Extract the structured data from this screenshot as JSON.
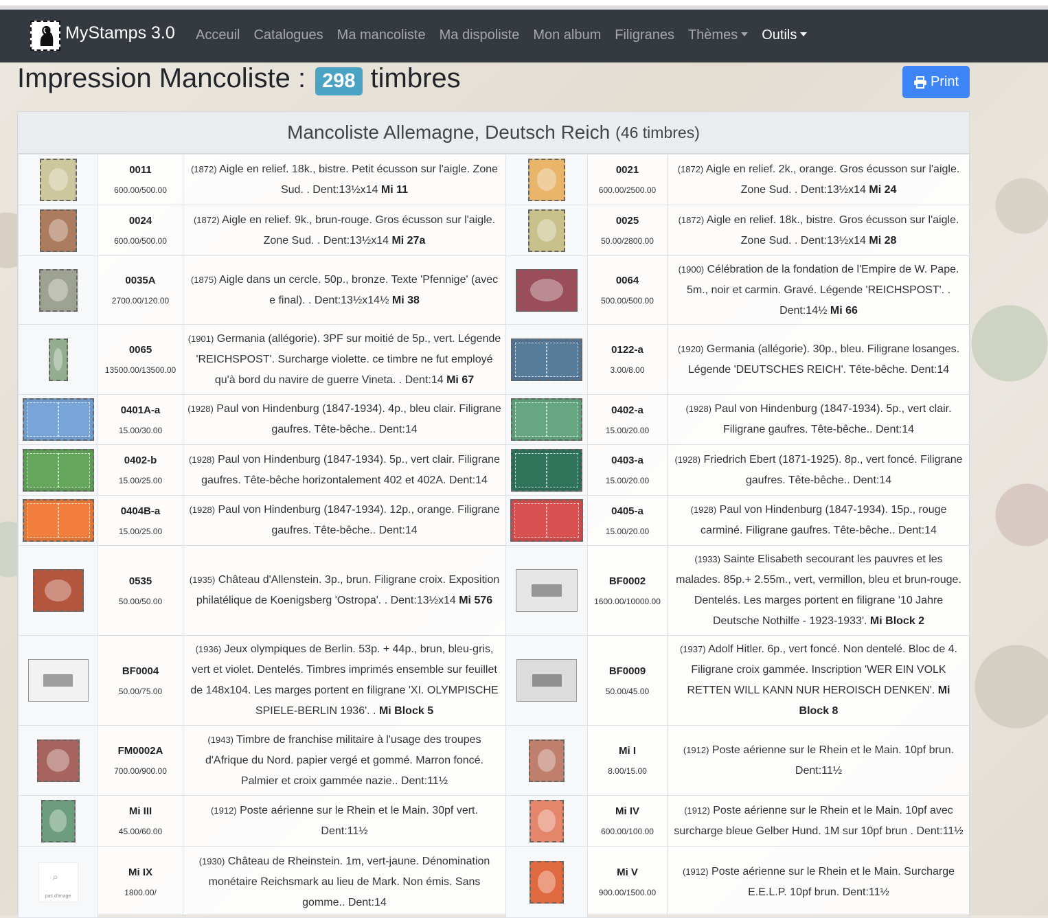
{
  "nav": {
    "brand": "MyStamps 3.0",
    "links": [
      "Acceuil",
      "Catalogues",
      "Ma mancoliste",
      "Ma dispoliste",
      "Mon album",
      "Filigranes",
      "Thèmes",
      "Outils"
    ]
  },
  "page": {
    "title": "Impression Mancoliste :",
    "count": "298",
    "unit": "timbres",
    "print_label": "Print"
  },
  "panel": {
    "title": "Mancoliste Allemagne, Deutsch Reich",
    "count": "(46 timbres)"
  },
  "rows": [
    [
      {
        "code": "0011",
        "price": "600.00/500.00",
        "year": "(1872)",
        "text": "Aigle en relief. 18k., bistre. Petit écusson sur l'aigle. Zone Sud. . Dent:13½x14",
        "mi": "Mi 11",
        "color": "#ccc79c"
      },
      {
        "code": "0021",
        "price": "600.00/2500.00",
        "year": "(1872)",
        "text": "Aigle en relief. 2k., orange. Gros écusson sur l'aigle. Zone Sud. . Dent:13½x14",
        "mi": "Mi 24",
        "color": "#e9b56a"
      }
    ],
    [
      {
        "code": "0024",
        "price": "600.00/500.00",
        "year": "(1872)",
        "text": "Aigle en relief. 9k., brun-rouge. Gros écusson sur l'aigle. Zone Sud. . Dent:13½x14",
        "mi": "Mi 27a",
        "color": "#ad7b5d"
      },
      {
        "code": "0025",
        "price": "50.00/2800.00",
        "year": "(1872)",
        "text": "Aigle en relief. 18k., bistre. Gros écusson sur l'aigle. Zone Sud. . Dent:13½x14",
        "mi": "Mi 28",
        "color": "#c8c18b"
      }
    ],
    [
      {
        "code": "0035A",
        "price": "2700.00/120.00",
        "year": "(1875)",
        "text": "Aigle dans un cercle. 50p., bronze. Texte 'Pfennige' (avec e final). . Dent:13½x14½",
        "mi": "Mi 38",
        "color": "#9ea293"
      },
      {
        "code": "0064",
        "price": "500.00/500.00",
        "year": "(1900)",
        "text": "Célébration de la fondation de l'Empire de W. Pape. 5m., noir et carmin. Gravé. Légende 'REICHSPOST'. . Dent:14½",
        "mi": "Mi 66",
        "color": "#9a4d5b"
      }
    ],
    [
      {
        "code": "0065",
        "price": "13500.00/13500.00",
        "year": "(1901)",
        "text": "Germania (allégorie). 3PF sur moitié de 5p., vert. Légende 'REICHSPOST'. Surcharge violette. ce timbre ne fut employé qu'à bord du navire de guerre Vineta. . Dent:14",
        "mi": "Mi 67",
        "color": "#93ad8f"
      },
      {
        "code": "0122-a",
        "price": "3.00/8.00",
        "year": "(1920)",
        "text": "Germania (allégorie). 30p., bleu. Filigrane losanges. Légende 'DEUTSCHES REICH'. Tête-bêche. Dent:14",
        "mi": "",
        "color": "#51738f"
      }
    ],
    [
      {
        "code": "0401A-a",
        "price": "15.00/30.00",
        "year": "(1928)",
        "text": "Paul von Hindenburg (1847-1934). 4p., bleu clair. Filigrane gaufres. Tête-bêche.. Dent:14",
        "mi": "",
        "color": "#6f99c8"
      },
      {
        "code": "0402-a",
        "price": "15.00/20.00",
        "year": "(1928)",
        "text": "Paul von Hindenburg (1847-1934). 5p., vert clair. Filigrane gaufres. Tête-bêche.. Dent:14",
        "mi": "",
        "color": "#5e9b78"
      }
    ],
    [
      {
        "code": "0402-b",
        "price": "15.00/25.00",
        "year": "(1928)",
        "text": "Paul von Hindenburg (1847-1934). 5p., vert clair. Filigrane gaufres. Tête-bêche horizontalement 402 et 402A. Dent:14",
        "mi": "",
        "color": "#5d9a55"
      },
      {
        "code": "0403-a",
        "price": "15.00/20.00",
        "year": "(1928)",
        "text": "Friedrich Ebert (1871-1925). 8p., vert foncé. Filigrane gaufres. Tête-bêche.. Dent:14",
        "mi": "",
        "color": "#2c6b55"
      }
    ],
    [
      {
        "code": "0404B-a",
        "price": "15.00/25.00",
        "year": "(1928)",
        "text": "Paul von Hindenburg (1847-1934). 12p., orange. Filigrane gaufres. Tête-bêche.. Dent:14",
        "mi": "",
        "color": "#df7538"
      },
      {
        "code": "0405-a",
        "price": "15.00/20.00",
        "year": "(1928)",
        "text": "Paul von Hindenburg (1847-1934). 15p., rouge carminé. Filigrane gaufres. Tête-bêche.. Dent:14",
        "mi": "",
        "color": "#c84a4a"
      }
    ],
    [
      {
        "code": "0535",
        "price": "50.00/50.00",
        "year": "(1935)",
        "text": "Château d'Allenstein. 3p., brun. Filigrane croix. Exposition philatélique de Koenigsberg 'Ostropa'. . Dent:13½x14",
        "mi": "Mi 576",
        "color": "#b4553d"
      },
      {
        "code": "BF0002",
        "price": "1600.00/10000.00",
        "year": "(1933)",
        "text": "Sainte Elisabeth secourant les pauvres et les malades. 85p.+ 2.55m., vert, vermillon, bleu et brun-rouge. Dentelés. Les marges portent en filigrane '10 Jahre Deutsche Nothilfe - 1923-1933'.",
        "mi": "Mi Block 2",
        "color": "#e6e6e6"
      }
    ],
    [
      {
        "code": "BF0004",
        "price": "50.00/75.00",
        "year": "(1936)",
        "text": "Jeux olympiques de Berlin. 53p. + 44p., brun, bleu-gris, vert et violet. Dentelés. Timbres imprimés ensemble sur feuillet de 148x104. Les marges portent en filigrane 'XI. OLYMPISCHE SPIELE-BERLIN 1936'. .",
        "mi": "Mi Block 5",
        "color": "#f2f2f2"
      },
      {
        "code": "BF0009",
        "price": "50.00/45.00",
        "year": "(1937)",
        "text": "Adolf Hitler. 6p., vert foncé. Non dentelé. Bloc de 4. Filigrane croix gammée. Inscription 'WER EIN VOLK RETTEN WILL KANN NUR HEROISCH DENKEN'.",
        "mi": "Mi Block 8",
        "color": "#dcdcdc"
      }
    ],
    [
      {
        "code": "FM0002A",
        "price": "700.00/900.00",
        "year": "(1943)",
        "text": "Timbre de franchise militaire à l'usage des troupes d'Afrique du Nord. papier vergé et gommé. Marron foncé. Palmier et croix gammée nazie.. Dent:11½",
        "mi": "",
        "color": "#a7635d"
      },
      {
        "code": "Mi I",
        "price": "8.00/15.00",
        "year": "(1912)",
        "text": "Poste aérienne sur le Rhein et le Main. 10pf brun. Dent:11½",
        "mi": "",
        "color": "#c07f6c"
      }
    ],
    [
      {
        "code": "Mi III",
        "price": "45.00/60.00",
        "year": "(1912)",
        "text": "Poste aérienne sur le Rhein et le Main. 30pf vert. Dent:11½",
        "mi": "",
        "color": "#6d9d7c"
      },
      {
        "code": "Mi IV",
        "price": "600.00/100.00",
        "year": "(1912)",
        "text": "Poste aérienne sur le Rhein et le Main. 10pf avec surcharge bleue Gelber Hund. 1M sur 10pf brun . Dent:11½",
        "mi": "",
        "color": "#e3866a"
      }
    ],
    [
      {
        "code": "Mi IX",
        "price": "1800.00/",
        "year": "(1930)",
        "text": "Château de Rheinstein. 1m, vert-jaune. Dénomination monétaire Reichsmark au lieu de Mark. Non émis. Sans gomme.. Dent:14",
        "mi": "",
        "color": "",
        "noimg_label": "pas d'image"
      },
      {
        "code": "Mi V",
        "price": "900.00/1500.00",
        "year": "(1912)",
        "text": "Poste aérienne sur le Rhein et le Main. Surcharge E.E.L.P. 10pf brun. Dent:11½",
        "mi": "",
        "color": "#e06a40"
      }
    ]
  ]
}
